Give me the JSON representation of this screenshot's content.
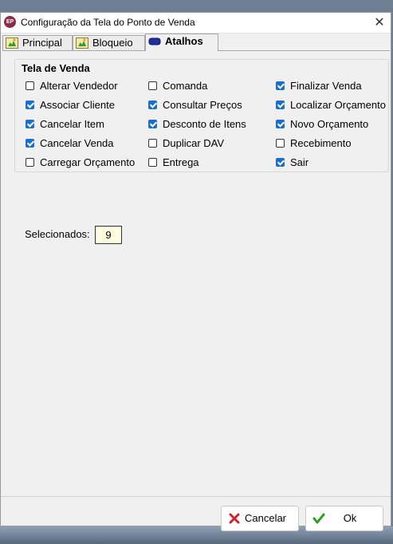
{
  "window": {
    "title": "Configuração da Tela do Ponto de Venda",
    "app_icon_text": "EP"
  },
  "tabs": [
    {
      "label": "Principal",
      "active": false
    },
    {
      "label": "Bloqueio",
      "active": false
    },
    {
      "label": "Atalhos",
      "active": true
    }
  ],
  "group": {
    "title": "Tela de Venda",
    "checkboxes": [
      {
        "label": "Alterar Vendedor",
        "checked": false
      },
      {
        "label": "Associar Cliente",
        "checked": true
      },
      {
        "label": "Cancelar Item",
        "checked": true
      },
      {
        "label": "Cancelar Venda",
        "checked": true
      },
      {
        "label": "Carregar Orçamento",
        "checked": false
      },
      {
        "label": "Comanda",
        "checked": false
      },
      {
        "label": "Consultar Preços",
        "checked": true
      },
      {
        "label": "Desconto de Itens",
        "checked": true
      },
      {
        "label": "Duplicar DAV",
        "checked": false
      },
      {
        "label": "Entrega",
        "checked": false
      },
      {
        "label": "Finalizar Venda",
        "checked": true
      },
      {
        "label": "Localizar Orçamento",
        "checked": true
      },
      {
        "label": "Novo Orçamento",
        "checked": true
      },
      {
        "label": "Recebimento",
        "checked": false
      },
      {
        "label": "Sair",
        "checked": true
      }
    ]
  },
  "selected": {
    "label": "Selecionados:",
    "value": "9"
  },
  "buttons": {
    "cancel": "Cancelar",
    "ok": "Ok"
  },
  "colors": {
    "check_accent": "#1a6fcf",
    "counter_bg": "#fffde0",
    "cancel_icon": "#d4202a",
    "ok_icon": "#2e9e1f"
  }
}
